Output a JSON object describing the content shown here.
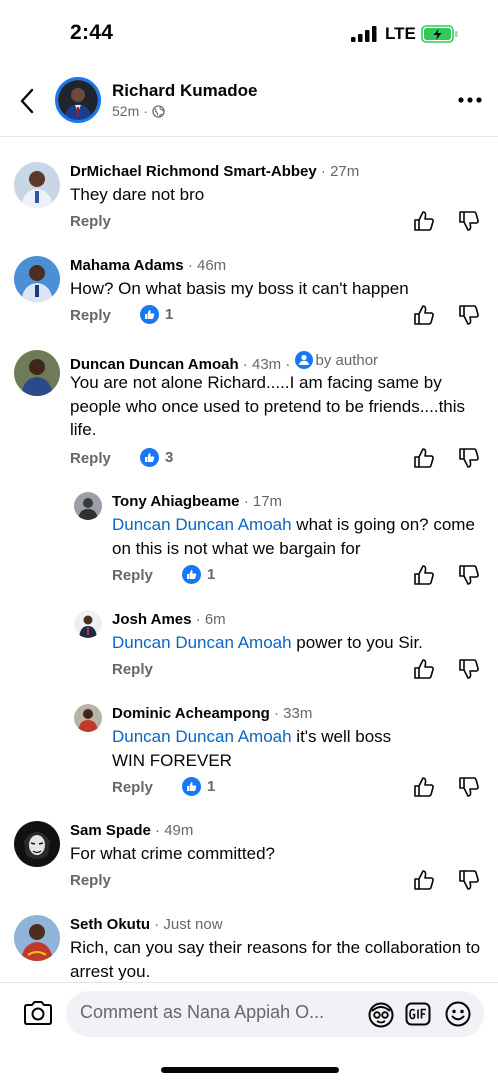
{
  "status_bar": {
    "time": "2:44",
    "network": "LTE",
    "battery_color": "#34c759"
  },
  "header": {
    "name": "Richard Kumadoe",
    "time": "52m",
    "separator": "·",
    "visibility_icon": "globe-icon"
  },
  "comments": [
    {
      "name": "DrMichael Richmond Smart-Abbey",
      "time": "27m",
      "text": "They dare not bro",
      "reply_label": "Reply"
    },
    {
      "name": "Mahama Adams",
      "time": "46m",
      "text": "How? On what basis my boss it can't happen",
      "reply_label": "Reply",
      "likes": "1"
    },
    {
      "name": "Duncan Duncan Amoah",
      "time": "43m",
      "author_badge": "by author",
      "text": "You are not alone Richard.....I am facing same by people who once used to pretend to be friends....this life.",
      "reply_label": "Reply",
      "likes": "3"
    },
    {
      "name": "Tony Ahiagbeame",
      "time": "17m",
      "mention": "Duncan Duncan Amoah",
      "text": " what is going on? come on this is not what we bargain for",
      "reply_label": "Reply",
      "likes": "1"
    },
    {
      "name": "Josh Ames",
      "time": "6m",
      "mention": "Duncan Duncan Amoah",
      "text": " power to you Sir.",
      "reply_label": "Reply"
    },
    {
      "name": "Dominic Acheampong",
      "time": "33m",
      "mention": "Duncan Duncan Amoah",
      "text": " it's well boss",
      "text2": "WIN FOREVER",
      "reply_label": "Reply",
      "likes": "1"
    },
    {
      "name": "Sam Spade",
      "time": "49m",
      "text": "For what crime committed?",
      "reply_label": "Reply"
    },
    {
      "name": "Seth Okutu",
      "time": "Just now",
      "text": "Rich, can you say their reasons for the collaboration to arrest you."
    }
  ],
  "composer": {
    "placeholder": "Comment as Nana Appiah O..."
  },
  "colors": {
    "accent": "#1877f2",
    "mention": "#0a66c2",
    "secondary_text": "#65676b"
  }
}
